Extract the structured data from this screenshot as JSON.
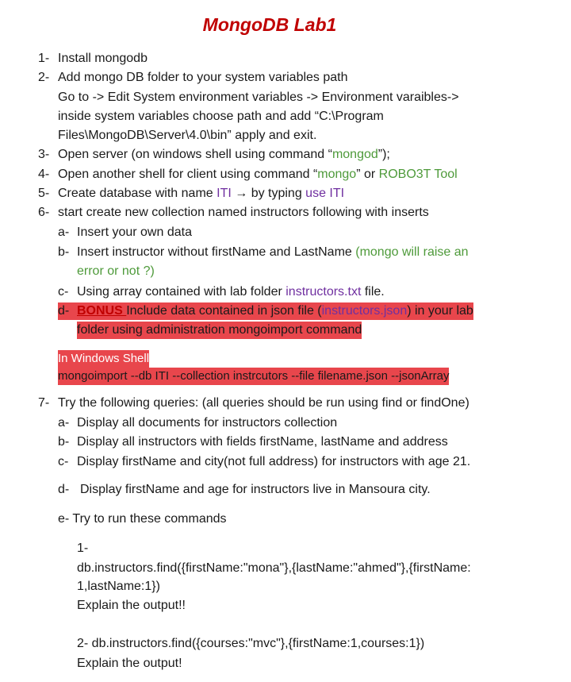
{
  "title": "MongoDB Lab1",
  "items": {
    "i1": {
      "num": "1-",
      "text": "Install mongodb"
    },
    "i2": {
      "num": "2-",
      "text": "Add mongo DB folder to your system variables path",
      "l2": "Go to -> Edit System environment variables -> Environment varaibles->",
      "l3": "inside system variables  choose path and add “C:\\Program",
      "l4": "Files\\MongoDB\\Server\\4.0\\bin” apply and exit."
    },
    "i3": {
      "num": "3-",
      "a": "Open server (on windows shell using command “",
      "cmd": "mongod",
      "b": "”);"
    },
    "i4": {
      "num": "4-",
      "a": "Open another shell for client using command “",
      "cmd": "mongo",
      "b": "” or ",
      "tool": "ROBO3T Tool"
    },
    "i5": {
      "num": "5-",
      "a": "Create database with name ",
      "iti": "ITI",
      "arrow": " → ",
      "b": "by typing  ",
      "use": "use ITI"
    },
    "i6": {
      "num": "6-",
      "text": "start create new collection named instructors following with inserts",
      "a": {
        "num": "a-",
        "text": "Insert your own data"
      },
      "b": {
        "num": "b-",
        "text": "Insert instructor without firstName and LastName ",
        "note1": "(mongo will raise an",
        "note2": "error or not ?)"
      },
      "c": {
        "num": "c-",
        "text": "Using array contained with lab folder ",
        "file": "instructors.txt",
        "end": " file."
      },
      "d": {
        "num": "d-",
        "bonus": "BONUS ",
        "t1": "Include data contained in json file (",
        "file": "instructors.json",
        "t2": ") in your lab",
        "l2": "folder using administration mongoimport command"
      }
    },
    "shell": {
      "label": "In Windows Shell",
      "cmd": "mongoimport --db ITI --collection instrcutors --file filename.json --jsonArray"
    },
    "i7": {
      "num": "7-",
      "text": "Try the following queries: (all queries should be run using find or findOne)",
      "a": {
        "num": "a-",
        "text": "Display all documents for instructors collection"
      },
      "b": {
        "num": "b-",
        "text": "Display all instructors with fields firstName, lastName and address"
      },
      "c": {
        "num": "c-",
        "text": "Display firstName and city(not full address) for instructors with age 21."
      },
      "d": {
        "num": "d-",
        "text": "Display firstName and age for instructors live in Mansoura city."
      },
      "e": {
        "text": "e- Try to run these commands",
        "q1num": "1-",
        "q1": "db.instructors.find({firstName:\"mona\"},{lastName:\"ahmed\"},{firstName:",
        "q1b": "1,lastName:1})",
        "q1x": "Explain the output!!",
        "q2": "2- db.instructors.find({courses:\"mvc\"},{firstName:1,courses:1})",
        "q2x": "Explain the output!"
      }
    }
  }
}
